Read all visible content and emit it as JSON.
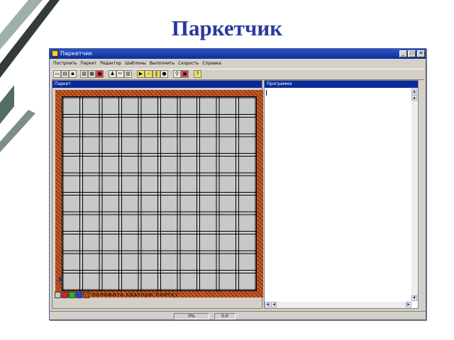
{
  "slide": {
    "title": "Паркетчик"
  },
  "window": {
    "title": "Паркетчик"
  },
  "controls": {
    "minimize": "_",
    "maximize": "□",
    "close": "✕"
  },
  "menu": [
    "Построить",
    "Паркет",
    "Редактор",
    "Шаблоны",
    "Выполнить",
    "Скорость",
    "Справка"
  ],
  "toolbar_icons": [
    "new-file-icon",
    "open-file-icon",
    "save-icon",
    "copy-icon",
    "print-icon",
    "export-icon",
    "tile-icon",
    "cut-icon",
    "paste-icon",
    "run-icon",
    "step-icon",
    "pause-icon",
    "stop-icon",
    "zoom-icon",
    "picture-icon",
    "help-icon"
  ],
  "panels": {
    "parquet": {
      "title": "Паркет"
    },
    "program": {
      "title": "Программа"
    }
  },
  "board": {
    "cols": 10,
    "rows": 10
  },
  "status": {
    "command_text": "положить красную плитку",
    "coords": "0:0",
    "percent": "0%"
  },
  "colors": {
    "swatches": [
      "#c8c8c8",
      "#e02020",
      "#20c020",
      "#2040e0",
      "#b04818"
    ]
  }
}
